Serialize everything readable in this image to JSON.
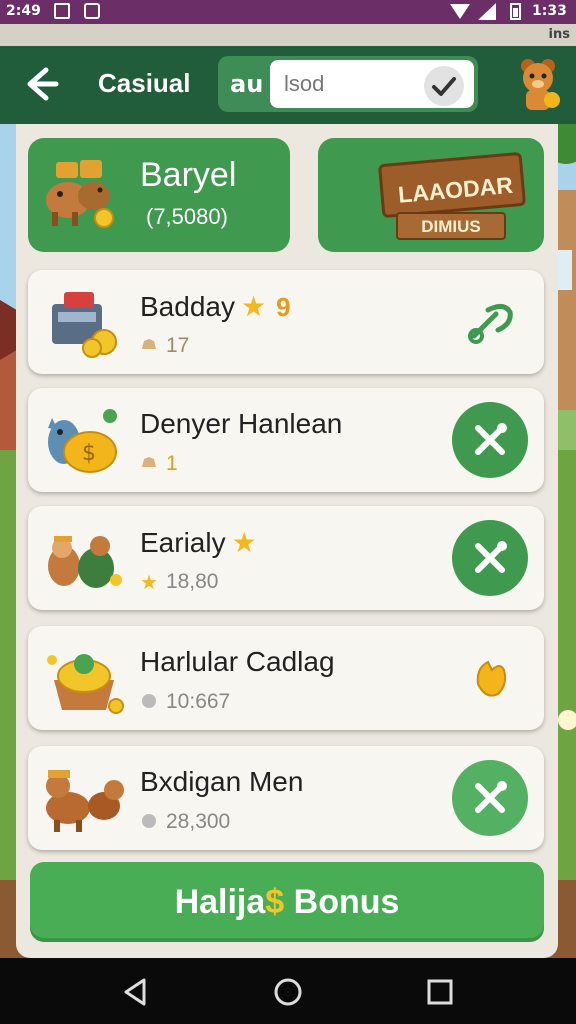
{
  "status_bar": {
    "time": "2:49",
    "right_time": "1:33"
  },
  "sub_strip": {
    "text": "ins"
  },
  "app_bar": {
    "title": "Casiual",
    "search_prefix": "au",
    "search_value": "lsod"
  },
  "top_cards": {
    "left": {
      "title": "Baryel",
      "subtitle": "(7,5080)"
    },
    "right": {
      "sign_title": "LAAODAR",
      "sign_subtitle": "DIMIUS"
    }
  },
  "rows": [
    {
      "title": "Badday",
      "has_star": true,
      "level": "9",
      "meta": "17",
      "meta_icon": "bread-icon",
      "action_icon": "pickaxe-outline-icon"
    },
    {
      "title": "Denyer Hanlean",
      "has_star": false,
      "level": "",
      "meta": "1",
      "meta_icon": "bread-icon",
      "action_icon": "cross-tools-icon"
    },
    {
      "title": "Earialy",
      "has_star": true,
      "level": "",
      "meta": "18,80",
      "meta_icon": "star-icon",
      "action_icon": "cross-tools-icon"
    },
    {
      "title": "Harlular Cadlag",
      "has_star": false,
      "level": "",
      "meta": "10:667",
      "meta_icon": "clock-icon",
      "action_icon": "gold-hand-icon"
    },
    {
      "title": "Bxdigan Men",
      "has_star": false,
      "level": "",
      "meta": "28,300",
      "meta_icon": "clock-icon",
      "action_icon": "cross-tools-icon"
    }
  ],
  "bonus_button": {
    "part_a": "Halija",
    "part_b": "$",
    "part_c": " Bonus"
  },
  "colors": {
    "status_bar": "#6b2e66",
    "app_bar": "#225d3b",
    "accent_green": "#3f9a4f",
    "gold": "#f4b81e"
  }
}
